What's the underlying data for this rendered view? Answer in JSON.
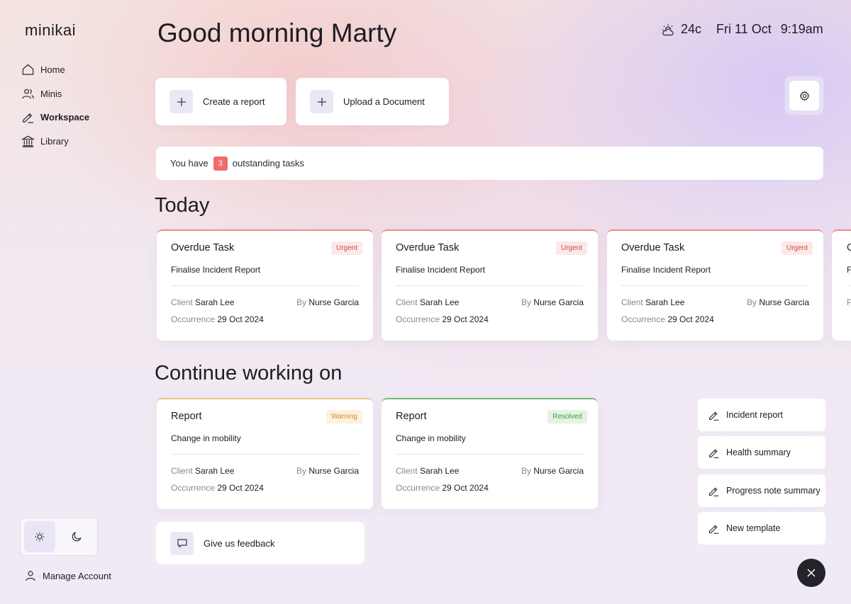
{
  "app": {
    "logo": "minikai"
  },
  "sidebar": {
    "items": [
      {
        "label": "Home",
        "icon": "home-icon",
        "active": false
      },
      {
        "label": "Minis",
        "icon": "users-icon",
        "active": false
      },
      {
        "label": "Workspace",
        "icon": "pencil-icon",
        "active": true
      },
      {
        "label": "Library",
        "icon": "library-icon",
        "active": false
      }
    ],
    "manage_account": "Manage Account",
    "theme": {
      "selected": "light"
    }
  },
  "header": {
    "greeting": "Good morning Marty",
    "temperature": "24c",
    "date": "Fri 11 Oct",
    "time": "9:19am"
  },
  "actions": {
    "create_report": "Create a report",
    "upload_document": "Upload a Document"
  },
  "tasks": {
    "prefix": "You have",
    "count": "3",
    "suffix": "outstanding tasks"
  },
  "today": {
    "title": "Today",
    "cards": [
      {
        "type": "Overdue Task",
        "badge": "Urgent",
        "task": "Finalise Incident Report",
        "client_label": "Client",
        "client": "Sarah Lee",
        "by_label": "By",
        "by": "Nurse Garcia",
        "occ_label": "Occurrence",
        "occurrence": "29 Oct 2024"
      },
      {
        "type": "Overdue Task",
        "badge": "Urgent",
        "task": "Finalise Incident Report",
        "client_label": "Client",
        "client": "Sarah Lee",
        "by_label": "By",
        "by": "Nurse Garcia",
        "occ_label": "Occurrence",
        "occurrence": "29 Oct 2024"
      },
      {
        "type": "Overdue Task",
        "badge": "Urgent",
        "task": "Finalise Incident Report",
        "client_label": "Client",
        "client": "Sarah Lee",
        "by_label": "By",
        "by": "Nurse Garcia",
        "occ_label": "Occurrence",
        "occurrence": "29 Oct 2024"
      },
      {
        "type": "O",
        "badge": "",
        "task": "F",
        "client_label": "P",
        "client": "",
        "by_label": "",
        "by": "",
        "occ_label": "",
        "occurrence": ""
      }
    ]
  },
  "continue": {
    "title": "Continue working on",
    "cards": [
      {
        "type": "Report",
        "badge": "Warning",
        "task": "Change in mobility",
        "client_label": "Client",
        "client": "Sarah Lee",
        "by_label": "By",
        "by": "Nurse Garcia",
        "occ_label": "Occurrence",
        "occurrence": "29 Oct 2024"
      },
      {
        "type": "Report",
        "badge": "Resolved",
        "task": "Change in mobility",
        "client_label": "Client",
        "client": "Sarah Lee",
        "by_label": "By",
        "by": "Nurse Garcia",
        "occ_label": "Occurrence",
        "occurrence": "29 Oct 2024"
      }
    ]
  },
  "feedback": {
    "label": "Give us feedback"
  },
  "templates": [
    {
      "label": "Incident report"
    },
    {
      "label": "Health summary"
    },
    {
      "label": "Progress note summary"
    },
    {
      "label": "New template"
    }
  ],
  "colors": {
    "accent": "#ebe8f6",
    "urgent": "#ee6d6d",
    "warning": "#f1c48a",
    "resolved": "#6fbf72"
  }
}
